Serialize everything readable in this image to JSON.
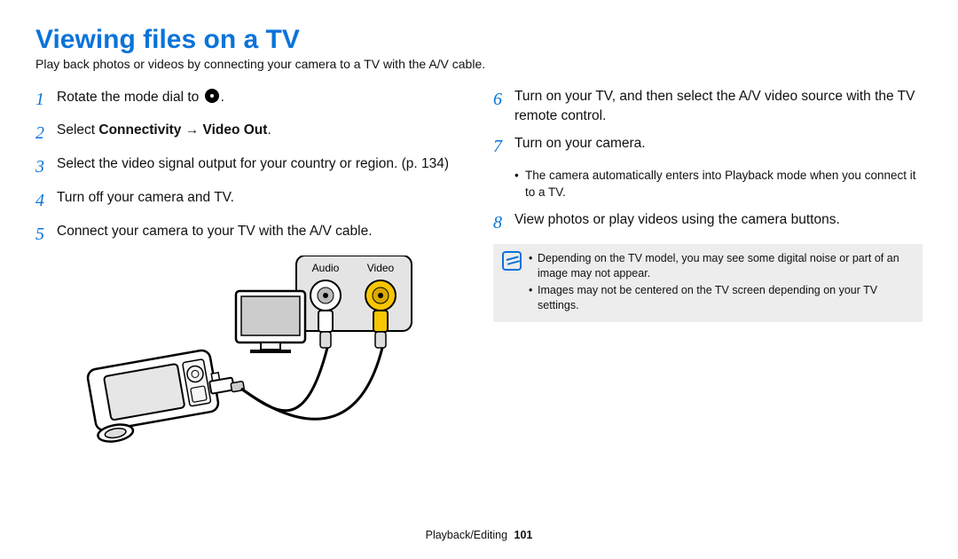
{
  "heading": "Viewing files on a TV",
  "subtitle": "Play back photos or videos by connecting your camera to a TV with the A/V cable.",
  "steps_left": [
    {
      "num": "1",
      "prefix": "Rotate the mode dial to ",
      "icon": true,
      "suffix": "."
    },
    {
      "num": "2",
      "prefix": "Select ",
      "bold": "Connectivity → Video Out",
      "suffix": "."
    },
    {
      "num": "3",
      "text": "Select the video signal output for your country or region. (p. 134)"
    },
    {
      "num": "4",
      "text": "Turn off your camera and TV."
    },
    {
      "num": "5",
      "text": "Connect your camera to your TV with the A/V cable."
    }
  ],
  "steps_right": [
    {
      "num": "6",
      "text": "Turn on your TV, and then select the A/V video source with the TV remote control."
    },
    {
      "num": "7",
      "text": "Turn on your camera.",
      "sub": [
        "The camera automatically enters into Playback mode when you connect it to a TV."
      ]
    },
    {
      "num": "8",
      "text": "View photos or play videos using the camera buttons."
    }
  ],
  "notes": [
    "Depending on the TV model, you may see some digital noise or part of an image may not appear.",
    "Images may not be centered on the TV screen depending on your TV settings."
  ],
  "illustration_labels": {
    "audio": "Audio",
    "video": "Video"
  },
  "footer": {
    "section": "Playback/Editing",
    "page": "101"
  }
}
